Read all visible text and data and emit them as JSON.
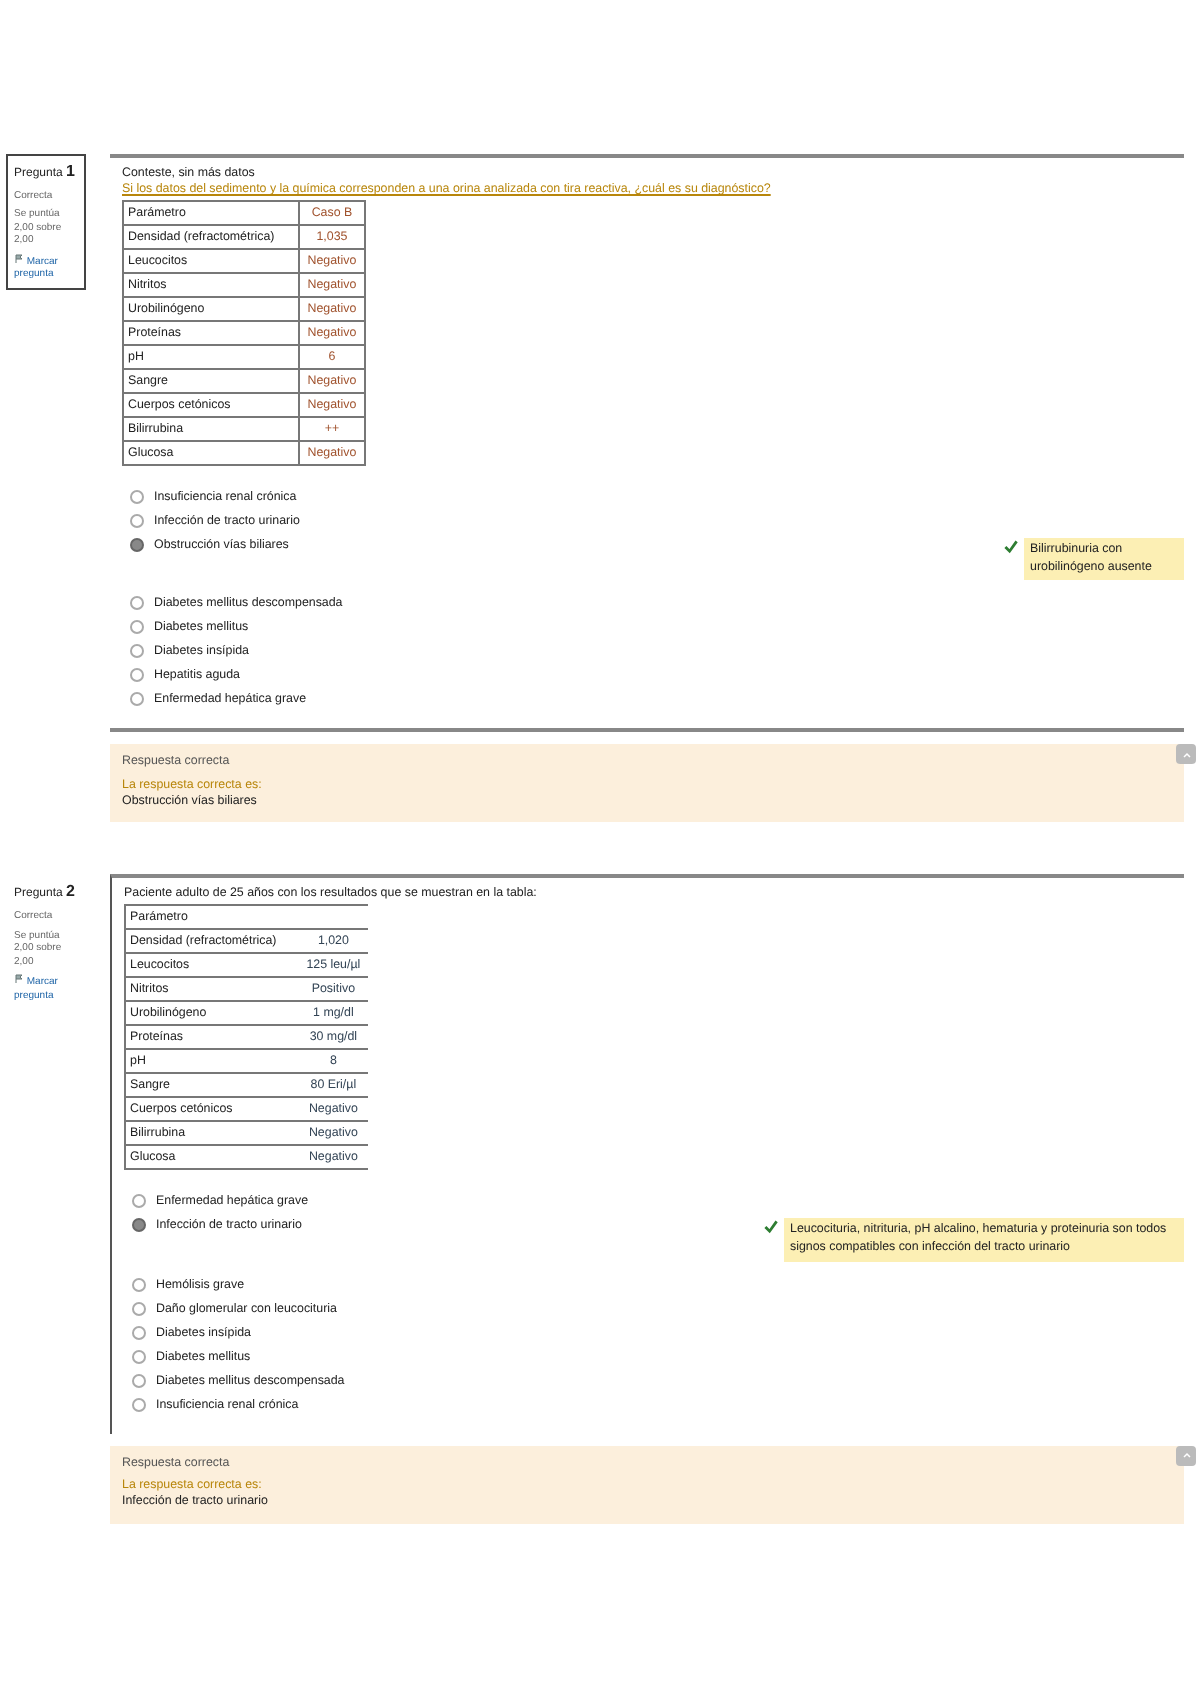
{
  "questions": [
    {
      "number": "Pregunta",
      "index": "1",
      "status": "Correcta",
      "score": "Se puntúa 2,00 sobre 2,00",
      "flag_label": "Marcar pregunta",
      "outlined": true,
      "intro": "Conteste, sin más datos",
      "prompt": "Si los datos del sedimento y la química corresponden a una orina analizada con tira reactiva, ¿cuál es su diagnóstico?",
      "table": {
        "kind": "boxed",
        "header": [
          "Parámetro",
          "Caso B"
        ],
        "rows": [
          [
            "Densidad (refractométrica)",
            "1,035"
          ],
          [
            "Leucocitos",
            "Negativo"
          ],
          [
            "Nitritos",
            "Negativo"
          ],
          [
            "Urobilinógeno",
            "Negativo"
          ],
          [
            "Proteínas",
            "Negativo"
          ],
          [
            "pH",
            "6"
          ],
          [
            "Sangre",
            "Negativo"
          ],
          [
            "Cuerpos cetónicos",
            "Negativo"
          ],
          [
            "Bilirrubina",
            "++"
          ],
          [
            "Glucosa",
            "Negativo"
          ]
        ]
      },
      "answers": [
        {
          "label": "Insuficiencia renal crónica",
          "selected": false
        },
        {
          "label": "Infección de tracto urinario",
          "selected": false
        },
        {
          "label": "Obstrucción vías biliares",
          "selected": true,
          "feedback": "Bilirrubinuria con urobilinógeno ausente"
        },
        {
          "label": "Diabetes mellitus descompensada",
          "selected": false
        },
        {
          "label": "Diabetes mellitus",
          "selected": false
        },
        {
          "label": "Diabetes insípida",
          "selected": false
        },
        {
          "label": "Hepatitis aguda",
          "selected": false
        },
        {
          "label": "Enfermedad hepática grave",
          "selected": false
        }
      ],
      "outcome": {
        "title": "Respuesta correcta",
        "lead": "La respuesta correcta es:",
        "answer": "Obstrucción vías biliares"
      }
    },
    {
      "number": "Pregunta",
      "index": "2",
      "status": "Correcta",
      "score": "Se puntúa 2,00 sobre 2,00",
      "flag_label": "Marcar pregunta",
      "outlined": false,
      "prompt": "Paciente adulto de 25 años con los resultados que se muestran en la tabla:",
      "table": {
        "kind": "lines",
        "header": [
          "Parámetro"
        ],
        "rows": [
          [
            "Densidad (refractométrica)",
            "1,020"
          ],
          [
            "Leucocitos",
            "125 leu/µl"
          ],
          [
            "Nitritos",
            "Positivo"
          ],
          [
            "Urobilinógeno",
            "1 mg/dl"
          ],
          [
            "Proteínas",
            "30 mg/dl"
          ],
          [
            "pH",
            "8"
          ],
          [
            "Sangre",
            "80 Eri/µl"
          ],
          [
            "Cuerpos cetónicos",
            "Negativo"
          ],
          [
            "Bilirrubina",
            "Negativo"
          ],
          [
            "Glucosa",
            "Negativo"
          ]
        ]
      },
      "answers": [
        {
          "label": "Enfermedad hepática grave",
          "selected": false
        },
        {
          "label": "Infección de tracto urinario",
          "selected": true,
          "feedback": "Leucocituria, nitrituria, pH alcalino, hematuria y proteinuria son todos signos compatibles con infección del tracto urinario"
        },
        {
          "label": "Hemólisis grave",
          "selected": false
        },
        {
          "label": "Daño glomerular con leucocituria",
          "selected": false
        },
        {
          "label": "Diabetes insípida",
          "selected": false
        },
        {
          "label": "Diabetes mellitus",
          "selected": false
        },
        {
          "label": "Diabetes mellitus descompensada",
          "selected": false
        },
        {
          "label": "Insuficiencia renal crónica",
          "selected": false
        }
      ],
      "outcome": {
        "title": "Respuesta correcta",
        "lead": "La respuesta correcta es:",
        "answer": "Infección de tracto urinario"
      }
    }
  ]
}
